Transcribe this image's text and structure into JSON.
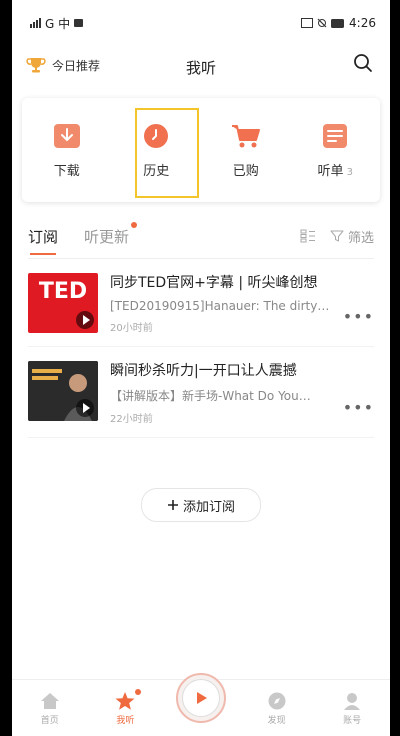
{
  "status": {
    "carrier": "G 中",
    "right": "4:26"
  },
  "header": {
    "recommend_label": "今日推荐",
    "title": "我听"
  },
  "quick_actions": [
    {
      "label": "下载",
      "icon": "download-icon"
    },
    {
      "label": "历史",
      "icon": "history-icon"
    },
    {
      "label": "已购",
      "icon": "cart-icon"
    },
    {
      "label": "听单",
      "badge": "3",
      "icon": "playlist-icon"
    }
  ],
  "tabs": [
    {
      "label": "订阅",
      "active": true
    },
    {
      "label": "听更新",
      "has_dot": true
    }
  ],
  "tab_tools": {
    "filter_label": "筛选"
  },
  "subscriptions": [
    {
      "thumb_text": "TED",
      "title": "同步TED官网+字幕 | 听尖峰创想",
      "desc": "[TED20190915]Hanauer: The dirty…",
      "time": "20小时前"
    },
    {
      "thumb_text": "",
      "title": "瞬间秒杀听力|一开口让人震撼",
      "desc": "【讲解版本】新手场-What Do You…",
      "time": "22小时前"
    }
  ],
  "add_subscription_label": "添加订阅",
  "bottom_nav": [
    {
      "label": "首页",
      "icon": "home-icon"
    },
    {
      "label": "我听",
      "icon": "star-icon",
      "active": true
    },
    {
      "label": "",
      "icon": "player-icon"
    },
    {
      "label": "发现",
      "icon": "compass-icon"
    },
    {
      "label": "账号",
      "icon": "account-icon"
    }
  ],
  "colors": {
    "accent": "#ef6b3f",
    "highlight_border": "#f3c52a",
    "ted_red": "#e01a22"
  }
}
